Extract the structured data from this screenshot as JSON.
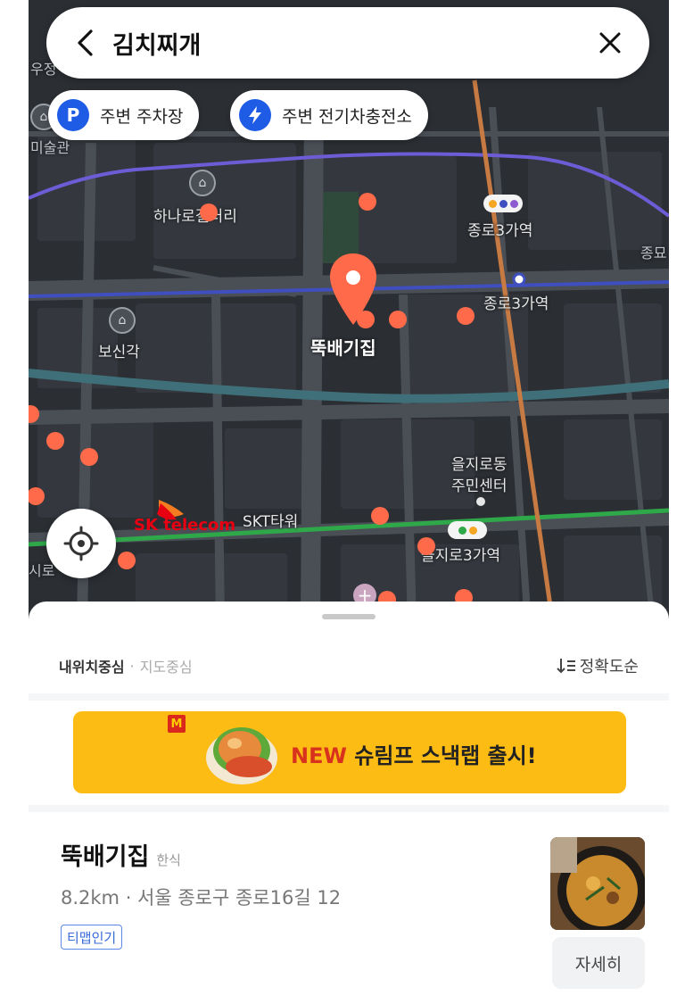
{
  "search": {
    "query": "김치찌개"
  },
  "chips": [
    {
      "icon_text": "P",
      "icon": "parking-icon",
      "label": "주변 주차장"
    },
    {
      "icon": "ev-charger-icon",
      "label": "주변 전기차충전소"
    }
  ],
  "map": {
    "labels": {
      "top_left_1": "우정",
      "top_left_2": "미술관",
      "gallery": "하나로갤러리",
      "station_jongno3_a": "종로3가역",
      "station_jongno3_b": "종로3가역",
      "right_edge": "종묘",
      "bosingak": "보신각",
      "selected_place": "뚝배기집",
      "euljiro_center_1": "을지로동",
      "euljiro_center_2": "주민센터",
      "skt_tower": "SKT타워",
      "station_euljiro3": "을지로3가역",
      "left_edge": "시로",
      "sk_logo_text": "SK telecom"
    },
    "pin_color": "#ff6b4a",
    "poi_color": "#ff6b4a"
  },
  "sheet": {
    "sort_mine": "내위치중심",
    "sort_separator": "·",
    "sort_map": "지도중심",
    "sort_order": "정확도순"
  },
  "ad": {
    "logo_text": "M",
    "new_label": "NEW",
    "text": " 슈림프 스낵랩 출시!"
  },
  "place": {
    "name": "뚝배기집",
    "category": "한식",
    "distance_address": "8.2km · 서울 종로구 종로16길 12",
    "badge": "티맵인기",
    "details_button": "자세히"
  }
}
